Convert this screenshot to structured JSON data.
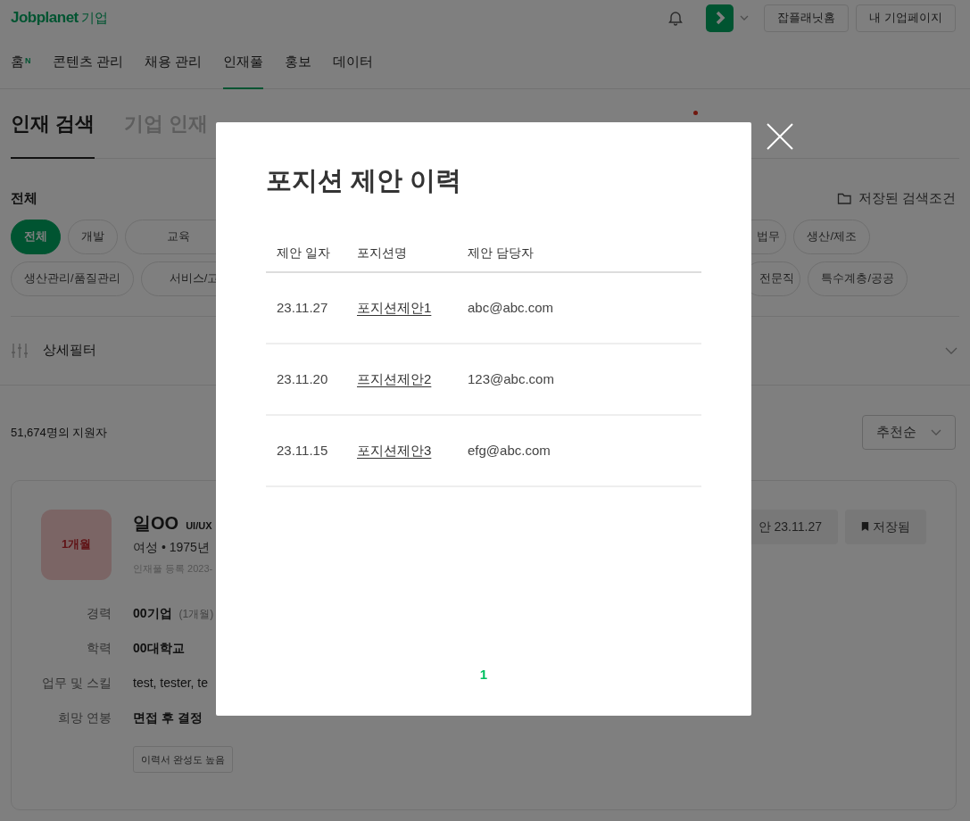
{
  "header": {
    "logo": "Jobplanet",
    "logo_suffix": "기업",
    "buttons": [
      "잡플래닛홈",
      "내 기업페이지"
    ]
  },
  "nav": [
    {
      "label": "홈",
      "badge": "N",
      "selected": false
    },
    {
      "label": "콘텐츠 관리",
      "selected": false
    },
    {
      "label": "채용 관리",
      "selected": false
    },
    {
      "label": "인재풀",
      "selected": true
    },
    {
      "label": "홍보",
      "selected": false
    },
    {
      "label": "데이터",
      "selected": false
    }
  ],
  "subtabs": [
    {
      "label": "인재 검색",
      "selected": true,
      "new": false
    },
    {
      "label": "기업 인재",
      "selected": false,
      "new": false
    },
    {
      "new": true
    }
  ],
  "filter": {
    "title": "전체",
    "saved": "저장된 검색조건",
    "chip_rows": [
      {
        "left": [
          {
            "label": "전체",
            "selected": true
          },
          {
            "label": "개발",
            "selected": false
          },
          {
            "label": "교육",
            "selected": false
          }
        ],
        "right": [
          {
            "label": "법무",
            "selected": false
          },
          {
            "label": "생산/제조",
            "selected": false
          }
        ]
      },
      {
        "left": [
          {
            "label": "생산관리/품질관리",
            "selected": false
          },
          {
            "label": "서비스/고",
            "selected": false
          }
        ],
        "right": [
          {
            "label": "전문직",
            "selected": false
          },
          {
            "label": "특수계층/공공",
            "selected": false
          }
        ]
      }
    ],
    "detail": "상세필터"
  },
  "results": {
    "count": "51,674명의 지원자",
    "sort": "추천순"
  },
  "candidate": {
    "tenure": "1개월",
    "name": "일OO",
    "headline": "UI/UX",
    "info": "여성 • 1975년",
    "registered": "인재풀 등록 2023-",
    "fields": [
      {
        "label": "경력",
        "value": "00기업",
        "note": "(1개월)",
        "kind": "strong"
      },
      {
        "label": "학력",
        "value": "00대학교",
        "kind": "strong"
      },
      {
        "label": "업무 및 스킬",
        "value": "test, tester, te",
        "kind": "plain"
      },
      {
        "label": "희망 연봉",
        "value": "면접 후 결정",
        "kind": "strong"
      }
    ],
    "tag": "이력서 완성도 높음",
    "offer": "안 23.11.27",
    "saved": "저장됨"
  },
  "modal": {
    "title": "포지션 제안 이력",
    "columns": [
      "제안 일자",
      "포지션명",
      "제안 담당자"
    ],
    "rows": [
      {
        "date": "23.11.27",
        "position": "포지션제안1",
        "manager": "abc@abc.com"
      },
      {
        "date": "23.11.20",
        "position": "프지션제안2",
        "manager": "123@abc.com"
      },
      {
        "date": "23.11.15",
        "position": "포지션제안3",
        "manager": "efg@abc.com"
      }
    ],
    "pages": [
      {
        "label": "1",
        "selected": true
      }
    ]
  }
}
